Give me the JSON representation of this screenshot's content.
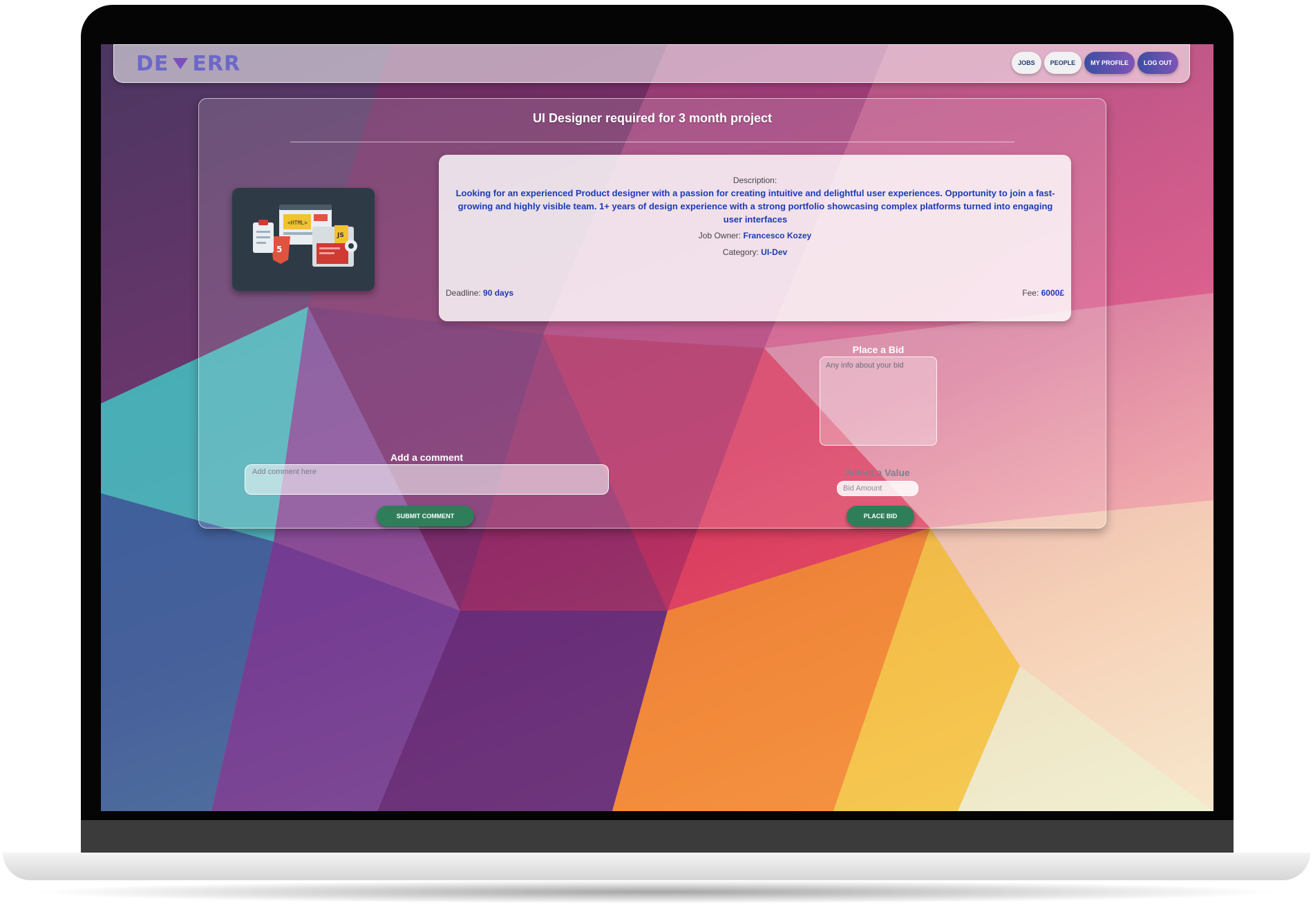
{
  "app": {
    "logo_left": "DE",
    "logo_right": "ERR"
  },
  "nav": {
    "jobs": "JOBS",
    "people": "PEOPLE",
    "my_profile": "MY PROFILE",
    "log_out": "LOG OUT"
  },
  "job": {
    "title": "UI Designer required for 3 month project",
    "description_label": "Description:",
    "description": "Looking for an experienced Product designer with a passion for creating intuitive and delightful user experiences. Opportunity to join a fast-growing and highly visible team. 1+ years of design experience with a strong portfolio showcasing complex platforms turned into engaging user interfaces",
    "owner_label": "Job Owner:",
    "owner": "Francesco Kozey",
    "category_label": "Category:",
    "category": "UI-Dev",
    "deadline_label": "Deadline:",
    "deadline": "90 days",
    "fee_label": "Fee:",
    "fee": "6000£"
  },
  "bid": {
    "heading": "Place a Bid",
    "info_placeholder": "Any info about your bid",
    "value_heading": "Select a Value",
    "amount_placeholder": "Bid Amount",
    "button": "PLACE BID"
  },
  "comment": {
    "heading": "Add a comment",
    "placeholder": "Add comment here",
    "button": "SUBMIT COMMENT"
  },
  "illustration_icons": [
    "html-icon",
    "html5-icon",
    "js-icon",
    "gear-icon",
    "clipboard-icon",
    "browser-window-icon",
    "code-window-icon"
  ]
}
